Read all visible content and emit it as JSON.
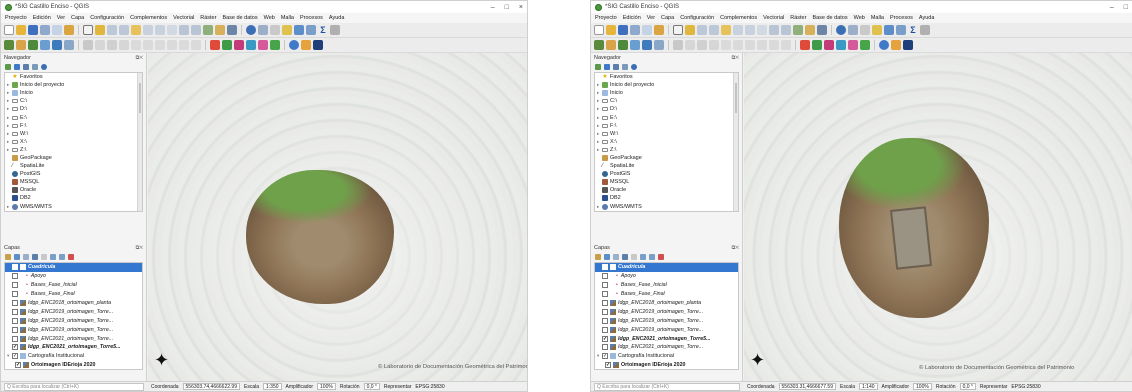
{
  "app_title": "*SIG Castillo Enciso - QGIS",
  "window_controls": {
    "minimize": "–",
    "maximize": "□",
    "close": "×"
  },
  "menu": [
    "Proyecto",
    "Edición",
    "Ver",
    "Capa",
    "Configuración",
    "Complementos",
    "Vectorial",
    "Ráster",
    "Base de datos",
    "Web",
    "Malla",
    "Procesos",
    "Ayuda"
  ],
  "browser_panel": {
    "title": "Navegador",
    "items": [
      {
        "label": "Favoritos",
        "icon": "star-icon",
        "expand": ""
      },
      {
        "label": "Inicio del proyecto",
        "icon": "folder-icon",
        "expand": "▸"
      },
      {
        "label": "Inicio",
        "icon": "folder-icon",
        "expand": "▸"
      },
      {
        "label": "C:\\",
        "icon": "drive-icon",
        "expand": "▸"
      },
      {
        "label": "D:\\",
        "icon": "drive-icon",
        "expand": "▸"
      },
      {
        "label": "E:\\",
        "icon": "drive-icon",
        "expand": "▸"
      },
      {
        "label": "F:\\",
        "icon": "drive-icon",
        "expand": "▸"
      },
      {
        "label": "W:\\",
        "icon": "drive-icon",
        "expand": "▸"
      },
      {
        "label": "X:\\",
        "icon": "drive-icon",
        "expand": "▸"
      },
      {
        "label": "Z:\\",
        "icon": "drive-icon",
        "expand": "▸"
      },
      {
        "label": "GeoPackage",
        "icon": "geopackage-icon",
        "expand": ""
      },
      {
        "label": "SpatiaLite",
        "icon": "spatialite-icon",
        "expand": ""
      },
      {
        "label": "PostGIS",
        "icon": "postgis-icon",
        "expand": ""
      },
      {
        "label": "MSSQL",
        "icon": "mssql-icon",
        "expand": ""
      },
      {
        "label": "Oracle",
        "icon": "oracle-icon",
        "expand": ""
      },
      {
        "label": "DB2",
        "icon": "db2-icon",
        "expand": ""
      },
      {
        "label": "WMS/WMTS",
        "icon": "wms-icon",
        "expand": "▸"
      }
    ]
  },
  "layers_panel": {
    "title": "Capas",
    "items": [
      {
        "label": "Cuadricula",
        "type": "vector",
        "checked": false,
        "selected": true
      },
      {
        "label": "Apoyo",
        "type": "point",
        "checked": false
      },
      {
        "label": "Bases_Fase_Inicial",
        "type": "point",
        "checked": false
      },
      {
        "label": "Bases_Fase_Final",
        "type": "point",
        "checked": false
      },
      {
        "label": "Idgp_ENC2018_ortoimagen_planta",
        "type": "raster",
        "checked": false
      },
      {
        "label": "Idgp_ENC2019_ortoimagen_Torre...",
        "type": "raster",
        "checked": false
      },
      {
        "label": "Idgp_ENC2019_ortoimagen_Torre...",
        "type": "raster",
        "checked": false
      },
      {
        "label": "Idgp_ENC2019_ortoimagen_Torre...",
        "type": "raster",
        "checked": false
      },
      {
        "label": "Idgp_ENC2021_ortoimagen_Torre...",
        "type": "raster",
        "checked": false
      },
      {
        "label": "Idgp_ENC2021_ortoimagen_Torre5...",
        "type": "raster",
        "checked": true
      },
      {
        "label": "Cartografía Institucional",
        "type": "group",
        "checked": true
      },
      {
        "label": "Ortoimagen IDErioja 2020",
        "type": "raster",
        "checked": true
      }
    ]
  },
  "map": {
    "credit": "© Laboratorio de Documentación Geométrica del Patrimonio",
    "north_arrow": "✦"
  },
  "statusbar": {
    "locator_placeholder": "Q Escriba para localizar (Ctrl+K)",
    "coord_label": "Coordenada",
    "coordinate_1": "556303.74,4666622.99",
    "coordinate_2": "556303.31,4666677.59",
    "scale_label": "Escala",
    "scale_1": "1:350",
    "scale_2": "1:140",
    "magnifier_label": "Amplificador",
    "magnifier": "100%",
    "rotation_label": "Rotación",
    "rotation": "0,0 °",
    "render_label": "Representar",
    "crs": "EPSG:25830"
  },
  "colors": {
    "selection": "#3377d0",
    "accent": "#1c4fa0"
  }
}
